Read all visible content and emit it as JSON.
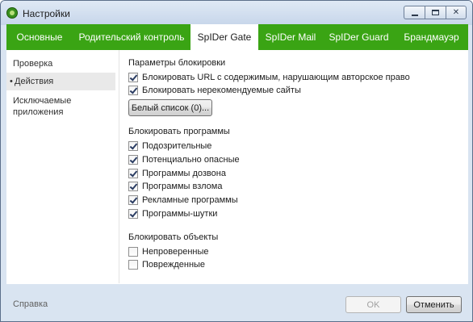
{
  "window": {
    "title": "Настройки",
    "controls": {
      "minimize": "minimize-icon",
      "maximize": "maximize-icon",
      "close": "close-icon"
    }
  },
  "tabs": [
    {
      "label": "Основные",
      "active": false
    },
    {
      "label": "Родительский контроль",
      "active": false
    },
    {
      "label": "SpIDer Gate",
      "active": true
    },
    {
      "label": "SpIDer Mail",
      "active": false
    },
    {
      "label": "SpIDer Guard",
      "active": false
    },
    {
      "label": "Брандмауэр",
      "active": false
    }
  ],
  "sidebar": {
    "items": [
      {
        "label": "Проверка",
        "active": false
      },
      {
        "label": "Действия",
        "active": true
      },
      {
        "label": "Исключаемые приложения",
        "active": false
      }
    ]
  },
  "blocking_params": {
    "title": "Параметры блокировки",
    "options": [
      {
        "label": "Блокировать URL с содержимым, нарушающим авторское право",
        "checked": true
      },
      {
        "label": "Блокировать нерекомендуемые сайты",
        "checked": true
      }
    ],
    "whitelist_button": "Белый список (0)..."
  },
  "block_programs": {
    "title": "Блокировать программы",
    "options": [
      {
        "label": "Подозрительные",
        "checked": true
      },
      {
        "label": "Потенциально опасные",
        "checked": true
      },
      {
        "label": "Программы дозвона",
        "checked": true
      },
      {
        "label": "Программы взлома",
        "checked": true
      },
      {
        "label": "Рекламные программы",
        "checked": true
      },
      {
        "label": "Программы-шутки",
        "checked": true
      }
    ]
  },
  "block_objects": {
    "title": "Блокировать объекты",
    "options": [
      {
        "label": "Непроверенные",
        "checked": false
      },
      {
        "label": "Поврежденные",
        "checked": false
      }
    ]
  },
  "footer": {
    "help": "Справка",
    "ok": "OK",
    "cancel": "Отменить"
  },
  "colors": {
    "tab_bar": "#3aa414",
    "window_frame": "#d9e4f1"
  }
}
